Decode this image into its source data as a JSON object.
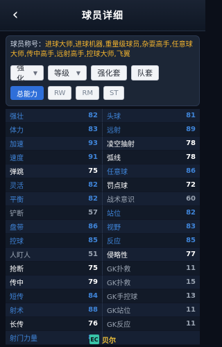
{
  "header": {
    "title": "球员详细",
    "back_icon": "chevron-left-icon"
  },
  "traits": {
    "label": "球员称号：",
    "value": "进球大师,进球机器,重量级球员,杂耍高手,任意球大师,传中高手,远射高手,控球大师,飞翼"
  },
  "filters": {
    "strengthen_label": "强化",
    "level_label": "等级",
    "strengthen_set_label": "强化套",
    "team_set_label": "队套"
  },
  "tabs": [
    {
      "label": "总能力",
      "active": true
    },
    {
      "label": "RW",
      "active": false
    },
    {
      "label": "RM",
      "active": false
    },
    {
      "label": "ST",
      "active": false
    }
  ],
  "stats": [
    {
      "name": "强壮",
      "value": "82",
      "color": "#3f84d8"
    },
    {
      "name": "头球",
      "value": "81",
      "color": "#3f84d8"
    },
    {
      "name": "体力",
      "value": "83",
      "color": "#3f84d8"
    },
    {
      "name": "远射",
      "value": "89",
      "color": "#3f84d8"
    },
    {
      "name": "加速",
      "value": "93",
      "color": "#3f84d8"
    },
    {
      "name": "凌空抽射",
      "value": "78",
      "color": "#ffffff"
    },
    {
      "name": "速度",
      "value": "91",
      "color": "#3f84d8"
    },
    {
      "name": "弧线",
      "value": "78",
      "color": "#ffffff"
    },
    {
      "name": "弹跳",
      "value": "75",
      "color": "#ffffff"
    },
    {
      "name": "任意球",
      "value": "86",
      "color": "#3f84d8"
    },
    {
      "name": "灵活",
      "value": "82",
      "color": "#3f84d8"
    },
    {
      "name": "罚点球",
      "value": "72",
      "color": "#ffffff"
    },
    {
      "name": "平衡",
      "value": "82",
      "color": "#3f84d8"
    },
    {
      "name": "战术意识",
      "value": "60",
      "color": "#9aa4b2"
    },
    {
      "name": "铲断",
      "value": "57",
      "color": "#9aa4b2"
    },
    {
      "name": "站位",
      "value": "82",
      "color": "#3f84d8"
    },
    {
      "name": "盘带",
      "value": "86",
      "color": "#3f84d8"
    },
    {
      "name": "视野",
      "value": "83",
      "color": "#3f84d8"
    },
    {
      "name": "控球",
      "value": "85",
      "color": "#3f84d8"
    },
    {
      "name": "反应",
      "value": "85",
      "color": "#3f84d8"
    },
    {
      "name": "人盯人",
      "value": "51",
      "color": "#9aa4b2"
    },
    {
      "name": "侵略性",
      "value": "77",
      "color": "#ffffff"
    },
    {
      "name": "抢断",
      "value": "75",
      "color": "#ffffff"
    },
    {
      "name": "GK扑救",
      "value": "11",
      "color": "#9aa4b2"
    },
    {
      "name": "传中",
      "value": "79",
      "color": "#ffffff"
    },
    {
      "name": "GK扑救",
      "value": "15",
      "color": "#9aa4b2"
    },
    {
      "name": "短传",
      "value": "84",
      "color": "#3f84d8"
    },
    {
      "name": "GK手控球",
      "value": "13",
      "color": "#9aa4b2"
    },
    {
      "name": "射术",
      "value": "88",
      "color": "#3f84d8"
    },
    {
      "name": "GK站位",
      "value": "11",
      "color": "#9aa4b2"
    },
    {
      "name": "长传",
      "value": "76",
      "color": "#ffffff"
    },
    {
      "name": "GK反应",
      "value": "11",
      "color": "#9aa4b2"
    },
    {
      "name": "射门力量",
      "value": "85",
      "color": "#3f84d8"
    },
    {
      "name": "",
      "value": "",
      "color": "#9aa4b2"
    }
  ],
  "footer": {
    "logo_text": "EC",
    "brand": "贝尔"
  }
}
